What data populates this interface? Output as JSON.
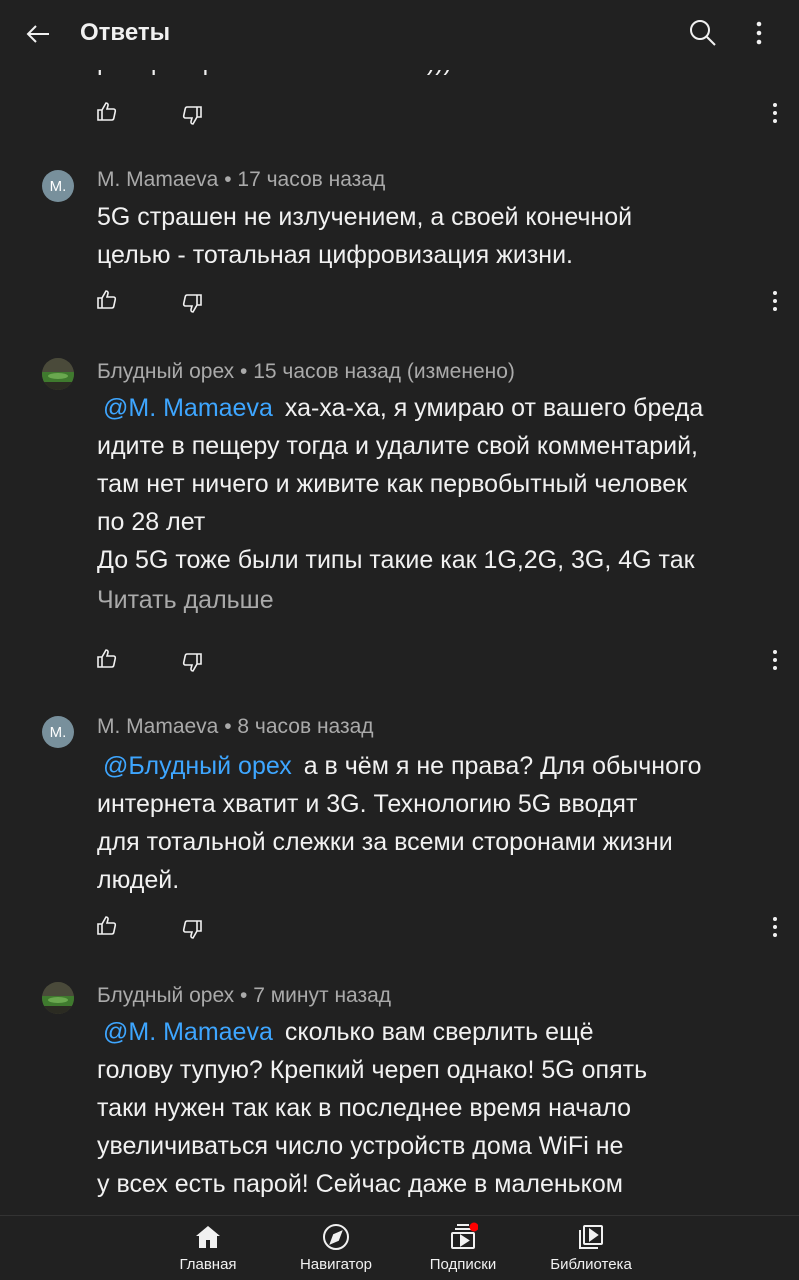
{
  "header": {
    "title": "Ответы",
    "back_icon": "arrow-left-icon",
    "search_icon": "search-icon",
    "menu_icon": "more-vertical-icon"
  },
  "previous_comment_tail": "распространяют в основном)))",
  "comments": [
    {
      "avatar_text": "M.",
      "author": "M. Mamaeva",
      "time": "17 часов назад",
      "lines": [
        "5G страшен не излучением, а своей конечной",
        "целью - тотальная цифровизация жизни."
      ]
    },
    {
      "avatar_text": "",
      "author": "Блудный орех",
      "time": "15 часов назад (изменено)",
      "mention": "@M. Mamaeva",
      "lines": [
        "ха-ха-ха, я умираю от вашего бреда",
        "идите в пещеру тогда и удалите свой комментарий,",
        "там нет ничего и живите как первобытный человек",
        "по 28 лет",
        "До 5G тоже были типы такие как 1G,2G, 3G, 4G так"
      ],
      "read_more": "Читать дальше"
    },
    {
      "avatar_text": "M.",
      "author": "M. Mamaeva",
      "time": "8 часов назад",
      "mention": "@Блудный орех",
      "lines": [
        "а в чём я не права? Для обычного",
        "интернета хватит и 3G. Технологию 5G вводят",
        "для тотальной слежки за всеми сторонами жизни",
        "людей."
      ]
    },
    {
      "avatar_text": "",
      "author": "Блудный орех",
      "time": "7 минут назад",
      "mention": "@M. Mamaeva",
      "lines": [
        "сколько вам сверлить ещё",
        "голову тупую? Крепкий череп однако! 5G опять",
        "таки нужен так как в последнее время начало",
        "увеличиваться число устройств дома WiFi не",
        "у всех есть парой! Сейчас даже в маленьком"
      ]
    }
  ],
  "meta_separator": " • ",
  "bottom_nav": [
    {
      "label": "Главная",
      "icon": "home-icon"
    },
    {
      "label": "Навигатор",
      "icon": "compass-icon"
    },
    {
      "label": "Подписки",
      "icon": "subscriptions-icon"
    },
    {
      "label": "Библиотека",
      "icon": "library-icon"
    }
  ],
  "colors": {
    "background": "#212121",
    "text": "#f1f1f1",
    "secondary": "#aaaaaa",
    "mention": "#3ea6ff",
    "badge": "#ff0000"
  }
}
